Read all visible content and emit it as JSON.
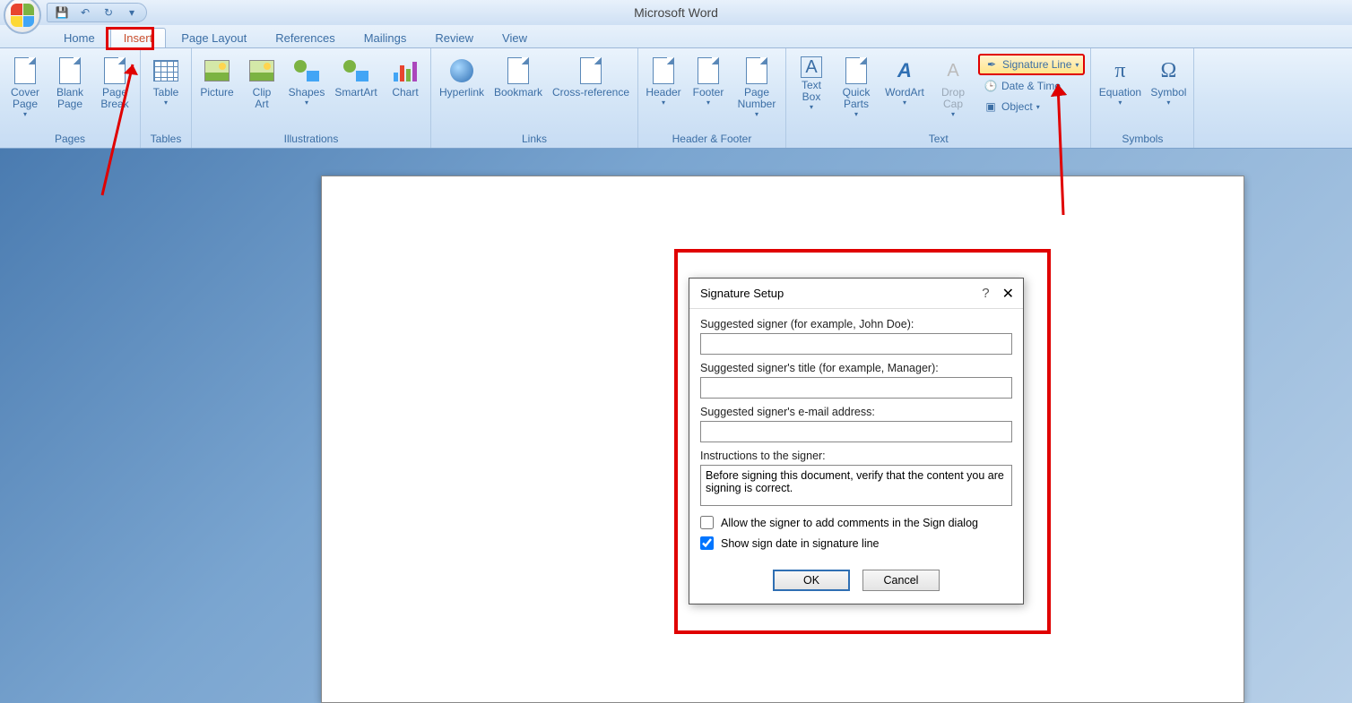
{
  "app_title": "Microsoft Word",
  "tabs": [
    "Home",
    "Insert",
    "Page Layout",
    "References",
    "Mailings",
    "Review",
    "View"
  ],
  "active_tab": "Insert",
  "ribbon": {
    "pages": {
      "label": "Pages",
      "cover": "Cover\nPage",
      "blank": "Blank\nPage",
      "break": "Page\nBreak"
    },
    "tables": {
      "label": "Tables",
      "table": "Table"
    },
    "illustrations": {
      "label": "Illustrations",
      "picture": "Picture",
      "clipart": "Clip\nArt",
      "shapes": "Shapes",
      "smartart": "SmartArt",
      "chart": "Chart"
    },
    "links": {
      "label": "Links",
      "hyperlink": "Hyperlink",
      "bookmark": "Bookmark",
      "crossref": "Cross-reference"
    },
    "headerfooter": {
      "label": "Header & Footer",
      "header": "Header",
      "footer": "Footer",
      "pagenum": "Page\nNumber"
    },
    "text": {
      "label": "Text",
      "textbox": "Text\nBox",
      "quickparts": "Quick\nParts",
      "wordart": "WordArt",
      "dropcap": "Drop\nCap",
      "sigline": "Signature Line",
      "datetime": "Date & Time",
      "object": "Object"
    },
    "symbols": {
      "label": "Symbols",
      "equation": "Equation",
      "symbol": "Symbol"
    }
  },
  "dialog": {
    "title": "Signature Setup",
    "signer_label": "Suggested signer (for example, John Doe):",
    "signer_value": "",
    "title_label": "Suggested signer's title (for example, Manager):",
    "title_value": "",
    "email_label": "Suggested signer's e-mail address:",
    "email_value": "",
    "instructions_label": "Instructions to the signer:",
    "instructions_value": "Before signing this document, verify that the content you are signing is correct.",
    "allow_comments_label": "Allow the signer to add comments in the Sign dialog",
    "allow_comments_checked": false,
    "show_date_label": "Show sign date in signature line",
    "show_date_checked": true,
    "ok": "OK",
    "cancel": "Cancel"
  }
}
